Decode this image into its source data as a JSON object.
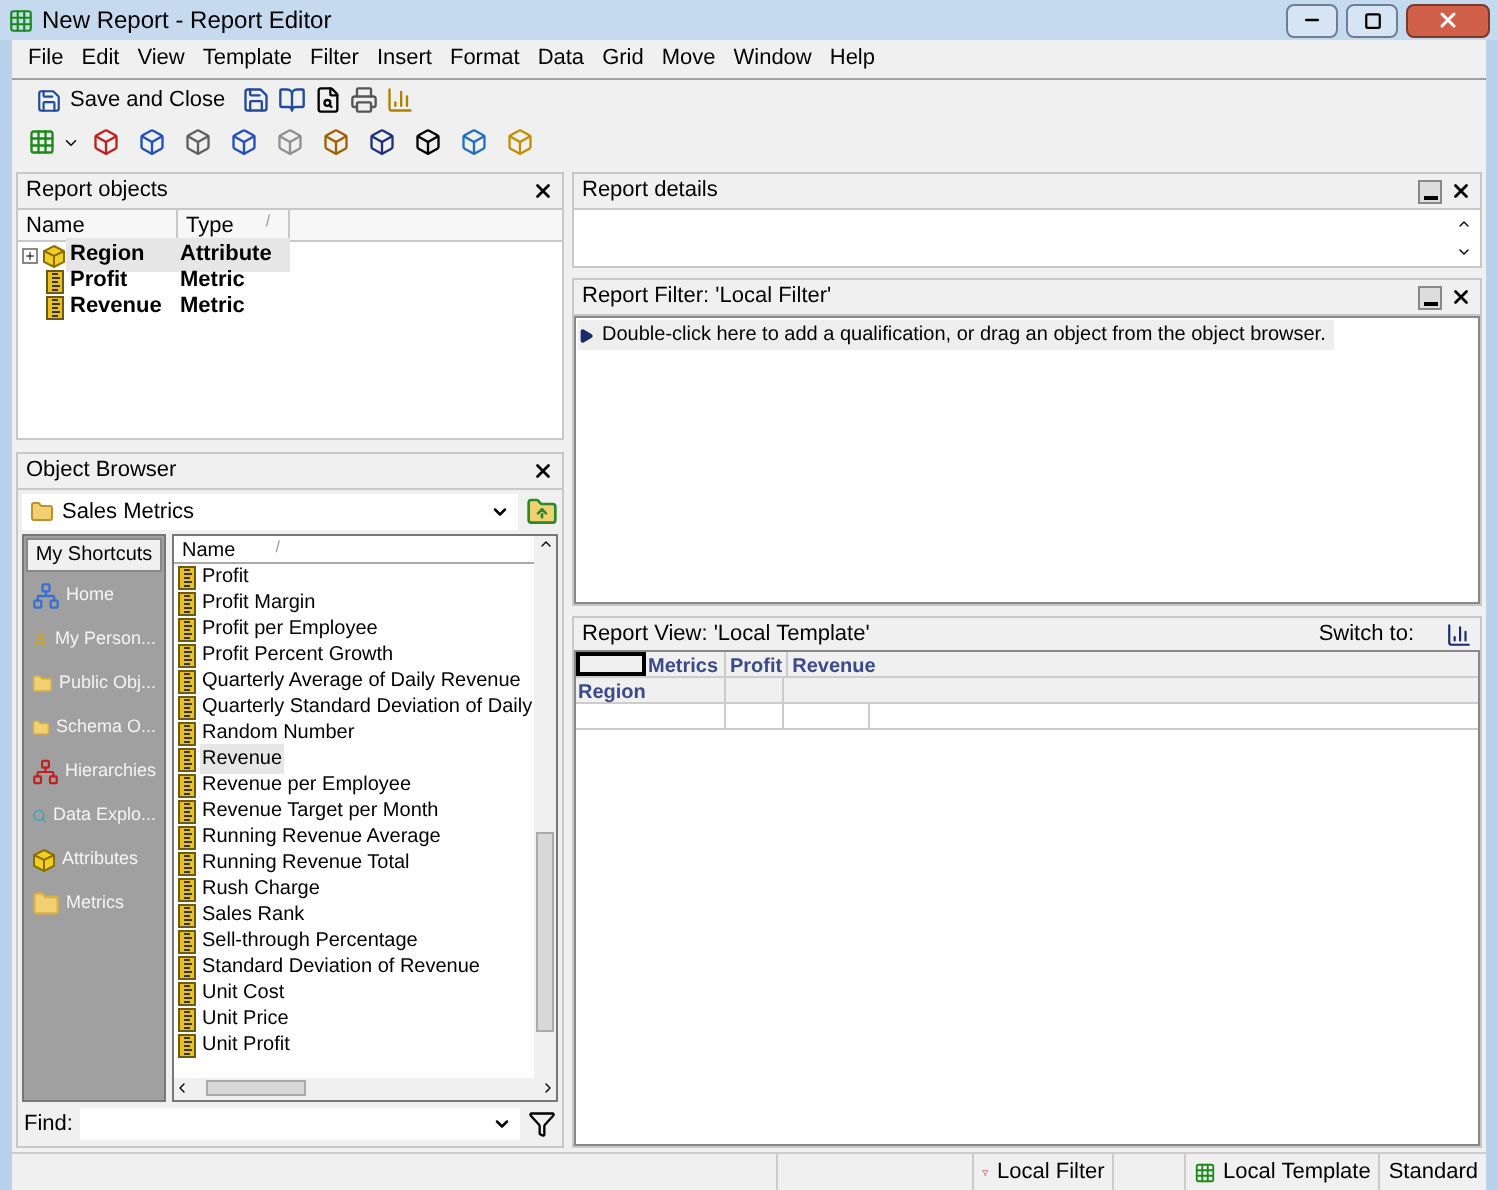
{
  "window": {
    "title": "New Report - Report Editor"
  },
  "menu": [
    "File",
    "Edit",
    "View",
    "Template",
    "Filter",
    "Insert",
    "Format",
    "Data",
    "Grid",
    "Move",
    "Window",
    "Help"
  ],
  "toolbar": {
    "save_label": "Save and Close"
  },
  "report_objects": {
    "title": "Report objects",
    "columns": [
      "Name",
      "Type"
    ],
    "sort_mark": "/",
    "rows": [
      {
        "name": "Region",
        "type": "Attribute",
        "kind": "attribute",
        "expanded": false,
        "selected": true
      },
      {
        "name": "Profit",
        "type": "Metric",
        "kind": "metric",
        "selected": false
      },
      {
        "name": "Revenue",
        "type": "Metric",
        "kind": "metric",
        "selected": false
      }
    ]
  },
  "object_browser": {
    "title": "Object Browser",
    "folder": "Sales Metrics",
    "shortcuts_title": "My Shortcuts",
    "shortcuts": [
      {
        "label": "Home",
        "kind": "network"
      },
      {
        "label": "My Person...",
        "kind": "person"
      },
      {
        "label": "Public Obj...",
        "kind": "folder"
      },
      {
        "label": "Schema O...",
        "kind": "folder"
      },
      {
        "label": "Hierarchies",
        "kind": "hierarchy"
      },
      {
        "label": "Data Explo...",
        "kind": "search"
      },
      {
        "label": "Attributes",
        "kind": "cube"
      },
      {
        "label": "Metrics",
        "kind": "folder"
      }
    ],
    "column": "Name",
    "sort_mark": "/",
    "items": [
      {
        "label": "Profit",
        "selected": false
      },
      {
        "label": "Profit Margin",
        "selected": false
      },
      {
        "label": "Profit per Employee",
        "selected": false
      },
      {
        "label": "Profit Percent Growth",
        "selected": false
      },
      {
        "label": "Quarterly Average of Daily Revenue",
        "selected": false
      },
      {
        "label": "Quarterly Standard Deviation of Daily",
        "selected": false
      },
      {
        "label": "Random Number",
        "selected": false
      },
      {
        "label": "Revenue",
        "selected": true
      },
      {
        "label": "Revenue per Employee",
        "selected": false
      },
      {
        "label": "Revenue Target per Month",
        "selected": false
      },
      {
        "label": "Running Revenue Average",
        "selected": false
      },
      {
        "label": "Running Revenue Total",
        "selected": false
      },
      {
        "label": "Rush Charge",
        "selected": false
      },
      {
        "label": "Sales Rank",
        "selected": false
      },
      {
        "label": "Sell-through Percentage",
        "selected": false
      },
      {
        "label": "Standard Deviation of Revenue",
        "selected": false
      },
      {
        "label": "Unit Cost",
        "selected": false
      },
      {
        "label": "Unit Price",
        "selected": false
      },
      {
        "label": "Unit Profit",
        "selected": false
      }
    ],
    "find_label": "Find:"
  },
  "report_details": {
    "title": "Report details"
  },
  "report_filter": {
    "title": "Report Filter: 'Local Filter'",
    "hint": "Double-click here to add a qualification, or drag an object from the object browser."
  },
  "report_view": {
    "title": "Report View: 'Local Template'",
    "switch_label": "Switch to:",
    "metrics_label": "Metrics",
    "metric_columns": [
      "Profit",
      "Revenue"
    ],
    "row_header": "Region"
  },
  "status_bar": {
    "filter": "Local Filter",
    "template": "Local Template",
    "mode": "Standard"
  }
}
